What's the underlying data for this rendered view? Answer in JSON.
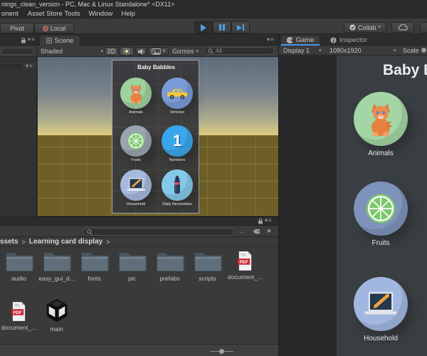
{
  "colors": {
    "accent_blue": "#4da0e8",
    "tab_underline_blue": "#4296e8",
    "pdf_red": "#cc2630"
  },
  "window": {
    "title": "nings_clean_version - PC, Mac & Linux Standalone* <DX11>"
  },
  "menu": {
    "items": [
      "onent",
      "Asset Store Tools",
      "Window",
      "Help"
    ]
  },
  "toolbar": {
    "pivot": "Pivot",
    "local": "Local",
    "collab": "Collab",
    "icons": [
      "globe-icon",
      "play-icon",
      "pause-icon",
      "step-icon",
      "collab-check-icon",
      "cloud-icon"
    ]
  },
  "scene": {
    "tab": "Scene",
    "draw_mode": "Shaded",
    "mode_2d": "2D",
    "gizmos": "Gizmos",
    "search_text": "All",
    "icons": [
      "sun-icon",
      "audio-icon",
      "image-icon",
      "search-icon"
    ],
    "card": {
      "title": "Baby Babbles",
      "tiles": [
        {
          "label": "Animals",
          "icon": "cat-icon",
          "bg": "#9ed3a0"
        },
        {
          "label": "Vehicles",
          "icon": "car-icon",
          "bg": "#7b9bd8"
        },
        {
          "label": "Fruits",
          "icon": "lime-icon",
          "bg": "#99a3b2"
        },
        {
          "label": "Numbers",
          "icon": "number-one-icon",
          "bg": "#3aa6ea"
        },
        {
          "label": "Household",
          "icon": "laptop-icon",
          "bg": "#a6b9de"
        },
        {
          "label": "Daily Necessities",
          "icon": "bottle-icon",
          "bg": "#84c9e8"
        }
      ]
    }
  },
  "game": {
    "tab": "Game",
    "inspector_tab": "Inspector",
    "display": "Display 1",
    "resolution": "1080x1920",
    "scale_label": "Scale",
    "title": "Baby Ba",
    "tiles": [
      {
        "label": "Animals",
        "icon": "cat-icon",
        "bg": "#a3d6a4"
      },
      {
        "label": "Fruits",
        "icon": "lime-icon",
        "bg": "#7e93bb"
      },
      {
        "label": "Household",
        "icon": "laptop-icon",
        "bg": "#a2b7e0"
      }
    ]
  },
  "project": {
    "breadcrumb": {
      "root": "ssets",
      "current": "Learning card display"
    },
    "pdf_badge": "PDF",
    "items": [
      {
        "label": "audio",
        "type": "folder"
      },
      {
        "label": "easy_gui_d...",
        "type": "folder"
      },
      {
        "label": "fonts",
        "type": "folder"
      },
      {
        "label": "pic",
        "type": "folder"
      },
      {
        "label": "prefabs",
        "type": "folder"
      },
      {
        "label": "scripts",
        "type": "folder"
      },
      {
        "label": "document_...",
        "type": "pdf"
      },
      {
        "label": "document_...",
        "type": "pdf"
      },
      {
        "label": "main",
        "type": "unity-scene"
      }
    ]
  }
}
